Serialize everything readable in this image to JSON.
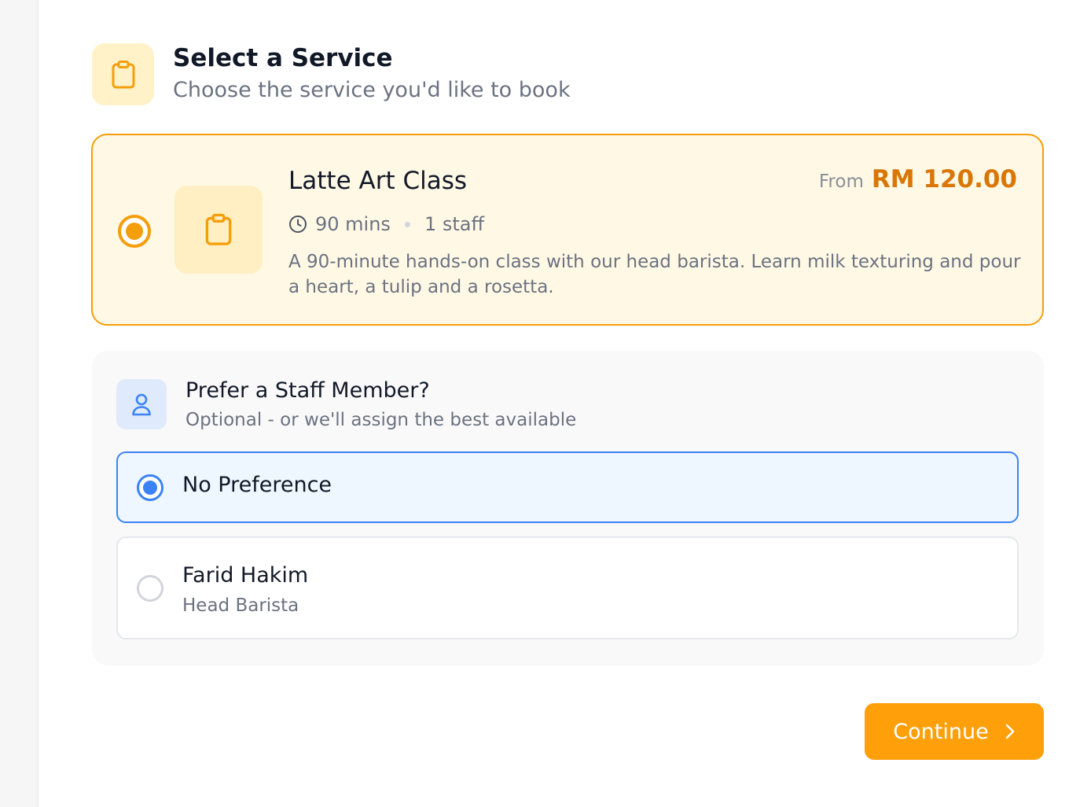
{
  "header": {
    "title": "Select a Service",
    "subtitle": "Choose the service you'd like to book",
    "icon": "clipboard-icon"
  },
  "service": {
    "name": "Latte Art Class",
    "price_prefix": "From",
    "price": "RM 120.00",
    "duration": "90 mins",
    "staff_count": "1 staff",
    "description": "A 90-minute hands-on class with our head barista. Learn milk texturing and pour a heart, a tulip and a rosetta.",
    "selected": true
  },
  "staff": {
    "title": "Prefer a Staff Member?",
    "subtitle": "Optional - or we'll assign the best available",
    "icon": "user-icon",
    "options": [
      {
        "name": "No Preference",
        "selected": true
      },
      {
        "name": "Farid Hakim",
        "role": "Head Barista",
        "selected": false
      }
    ]
  },
  "actions": {
    "continue_label": "Continue"
  },
  "colors": {
    "accent_orange": "#f59e0b",
    "accent_blue": "#3b82f6",
    "button": "#ff9f0a"
  }
}
